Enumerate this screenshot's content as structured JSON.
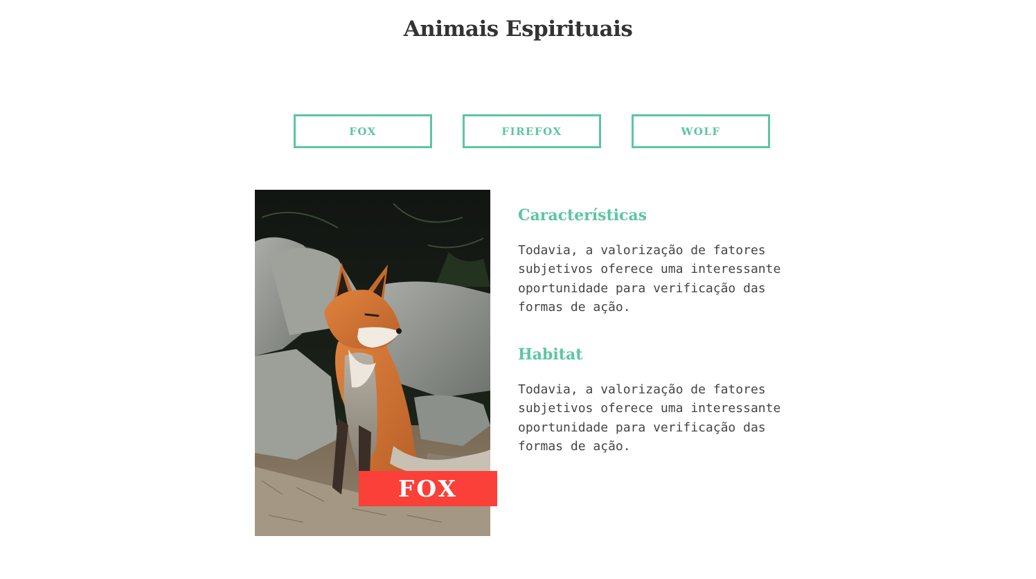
{
  "header": {
    "title": "Animais Espirituais"
  },
  "tabs": [
    {
      "label": "FOX"
    },
    {
      "label": "FIREFOX"
    },
    {
      "label": "WOLF"
    }
  ],
  "figure": {
    "caption": "FOX"
  },
  "info": {
    "sections": [
      {
        "heading": "Características",
        "text": "Todavia, a valorização de fatores subjetivos oferece uma interessante oportunidade para verificação das formas de ação."
      },
      {
        "heading": "Habitat",
        "text": "Todavia, a valorização de fatores subjetivos oferece uma interessante oportunidade para verificação das formas de ação."
      }
    ]
  },
  "colors": {
    "accent": "#5cc6a0",
    "caption_bg": "#fa4038",
    "title": "#333333",
    "body_text": "#444444"
  }
}
